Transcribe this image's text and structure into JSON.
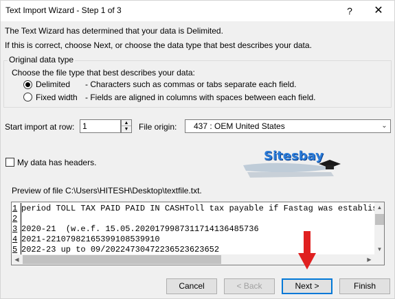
{
  "window": {
    "title": "Text Import Wizard - Step 1 of 3",
    "help_glyph": "?",
    "close_glyph": "✕"
  },
  "intro": {
    "line1": "The Text Wizard has determined that your data is Delimited.",
    "line2": "If this is correct, choose Next, or choose the data type that best describes your data."
  },
  "data_type": {
    "group_label": "Original data type",
    "prompt": "Choose the file type that best describes your data:",
    "options": [
      {
        "label": "Delimited",
        "description": "- Characters such as commas or tabs separate each field.",
        "selected": true
      },
      {
        "label": "Fixed width",
        "description": "- Fields are aligned in columns with spaces between each field.",
        "selected": false
      }
    ]
  },
  "start_import": {
    "label": "Start import at row:",
    "value": "1"
  },
  "file_origin": {
    "label": "File origin:",
    "value": "437 : OEM United States"
  },
  "headers_checkbox": {
    "label": "My data has headers.",
    "checked": false
  },
  "logo": {
    "text": "Sitesbay"
  },
  "preview": {
    "label": "Preview of file C:\\Users\\HITESH\\Desktop\\textfile.txt.",
    "rows": [
      {
        "num": "1",
        "text": "period TOLL TAX PAID PAID IN CASHToll tax payable if Fastag was establis"
      },
      {
        "num": "2",
        "text": ""
      },
      {
        "num": "3",
        "text": "2020-21  (w.e.f. 15.05.2020179987311714136485736"
      },
      {
        "num": "4",
        "text": "2021-22107982165399108539910"
      },
      {
        "num": "5",
        "text": "2022-23 up to 09/20224730472236523623652"
      }
    ]
  },
  "buttons": {
    "cancel": "Cancel",
    "back": "< Back",
    "next": "Next >",
    "finish": "Finish"
  },
  "colors": {
    "accent": "#0078d7",
    "annotation_arrow": "#e02020"
  }
}
